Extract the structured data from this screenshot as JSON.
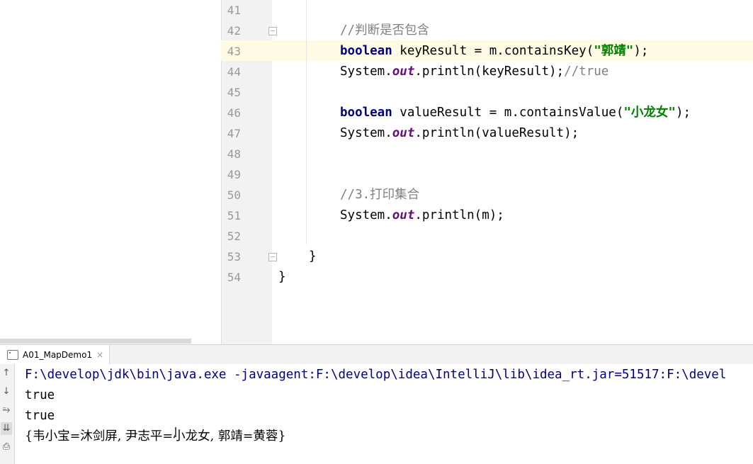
{
  "editor": {
    "line_numbers": [
      "41",
      "42",
      "43",
      "44",
      "45",
      "46",
      "47",
      "48",
      "49",
      "50",
      "51",
      "52",
      "53",
      "54"
    ],
    "lines": {
      "l42_comment": "//判断是否包含",
      "l43_kw": "boolean",
      "l43_code": " keyResult = m.containsKey(",
      "l43_str": "\"郭靖\"",
      "l43_end": ");",
      "l44_code_a": "System.",
      "l44_field": "out",
      "l44_code_b": ".println(keyResult);",
      "l44_comment": "//true",
      "l46_kw": "boolean",
      "l46_code": " valueResult = m.containsValue(",
      "l46_str": "\"小龙女\"",
      "l46_end": ");",
      "l47_code_a": "System.",
      "l47_field": "out",
      "l47_code_b": ".println(valueResult);",
      "l50_comment": "//3.打印集合",
      "l51_code_a": "System.",
      "l51_field": "out",
      "l51_code_b": ".println(m);",
      "l53_brace": "}",
      "l54_brace": "}"
    }
  },
  "run": {
    "tab_label": "A01_MapDemo1",
    "tab_close": "×",
    "toolbar_icons": [
      "arrow-up-icon",
      "arrow-down-icon",
      "soft-wrap-icon",
      "scroll-to-end-icon",
      "print-icon"
    ],
    "console": {
      "command": "F:\\develop\\jdk\\bin\\java.exe -javaagent:F:\\develop\\idea\\IntelliJ\\lib\\idea_rt.jar=51517:F:\\devel",
      "out1": "true",
      "out2": "true",
      "out3": "{韦小宝=沐剑屏, 尹志平=小龙女, 郭靖=黄蓉}"
    }
  },
  "colors": {
    "keyword": "#000080",
    "string": "#008000",
    "comment": "#808080",
    "field": "#660e7a",
    "caret_line": "#fffae3"
  }
}
